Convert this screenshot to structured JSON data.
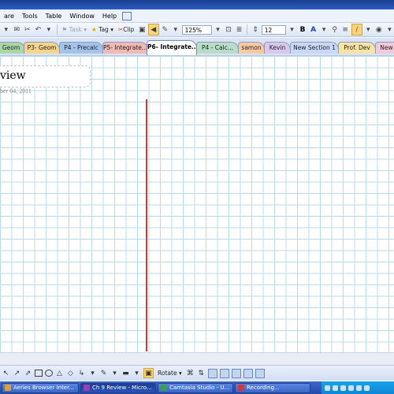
{
  "menu": {
    "items": [
      "are",
      "Tools",
      "Table",
      "Window",
      "Help"
    ]
  },
  "toolbar": {
    "task_label": "Task",
    "tag_label": "Tag",
    "clip_label": "Clip",
    "zoom_value": "125%",
    "font_size_value": "12",
    "bold_label": "B"
  },
  "section_tabs": [
    {
      "label": "Geom",
      "color": "#a9d6a5"
    },
    {
      "label": "P3- Geom",
      "color": "#f4d48c"
    },
    {
      "label": "P4 - Precalc",
      "color": "#a5c2ea"
    },
    {
      "label": "P5- Integrate...",
      "color": "#f0b9b4"
    },
    {
      "label": "P6- Integrate...",
      "color": "#ffffff"
    },
    {
      "label": "P4 - Calc...",
      "color": "#b9dcc8"
    },
    {
      "label": "samon",
      "color": "#f6c9a3"
    },
    {
      "label": "Kevin",
      "color": "#d9c8ee"
    },
    {
      "label": "New Section 1",
      "color": "#c7d9f4"
    },
    {
      "label": "Prof. Dev",
      "color": "#f6e3a6"
    },
    {
      "label": "New S",
      "color": "#f2c9d8"
    }
  ],
  "page": {
    "title": "view",
    "date": "ber 04, 2011",
    "grid_color": "#b9dbe9",
    "line_color": "#cc3a3a"
  },
  "drawing_toolbar": {
    "rotate_label": "Rotate"
  },
  "taskbar": {
    "items": [
      {
        "label": "Aeries Browser Inter...",
        "active": false
      },
      {
        "label": "Ch 9 Review - Micro...",
        "active": true
      },
      {
        "label": "Camtasia Studio - U...",
        "active": false
      },
      {
        "label": "Recording...",
        "active": false
      }
    ]
  }
}
